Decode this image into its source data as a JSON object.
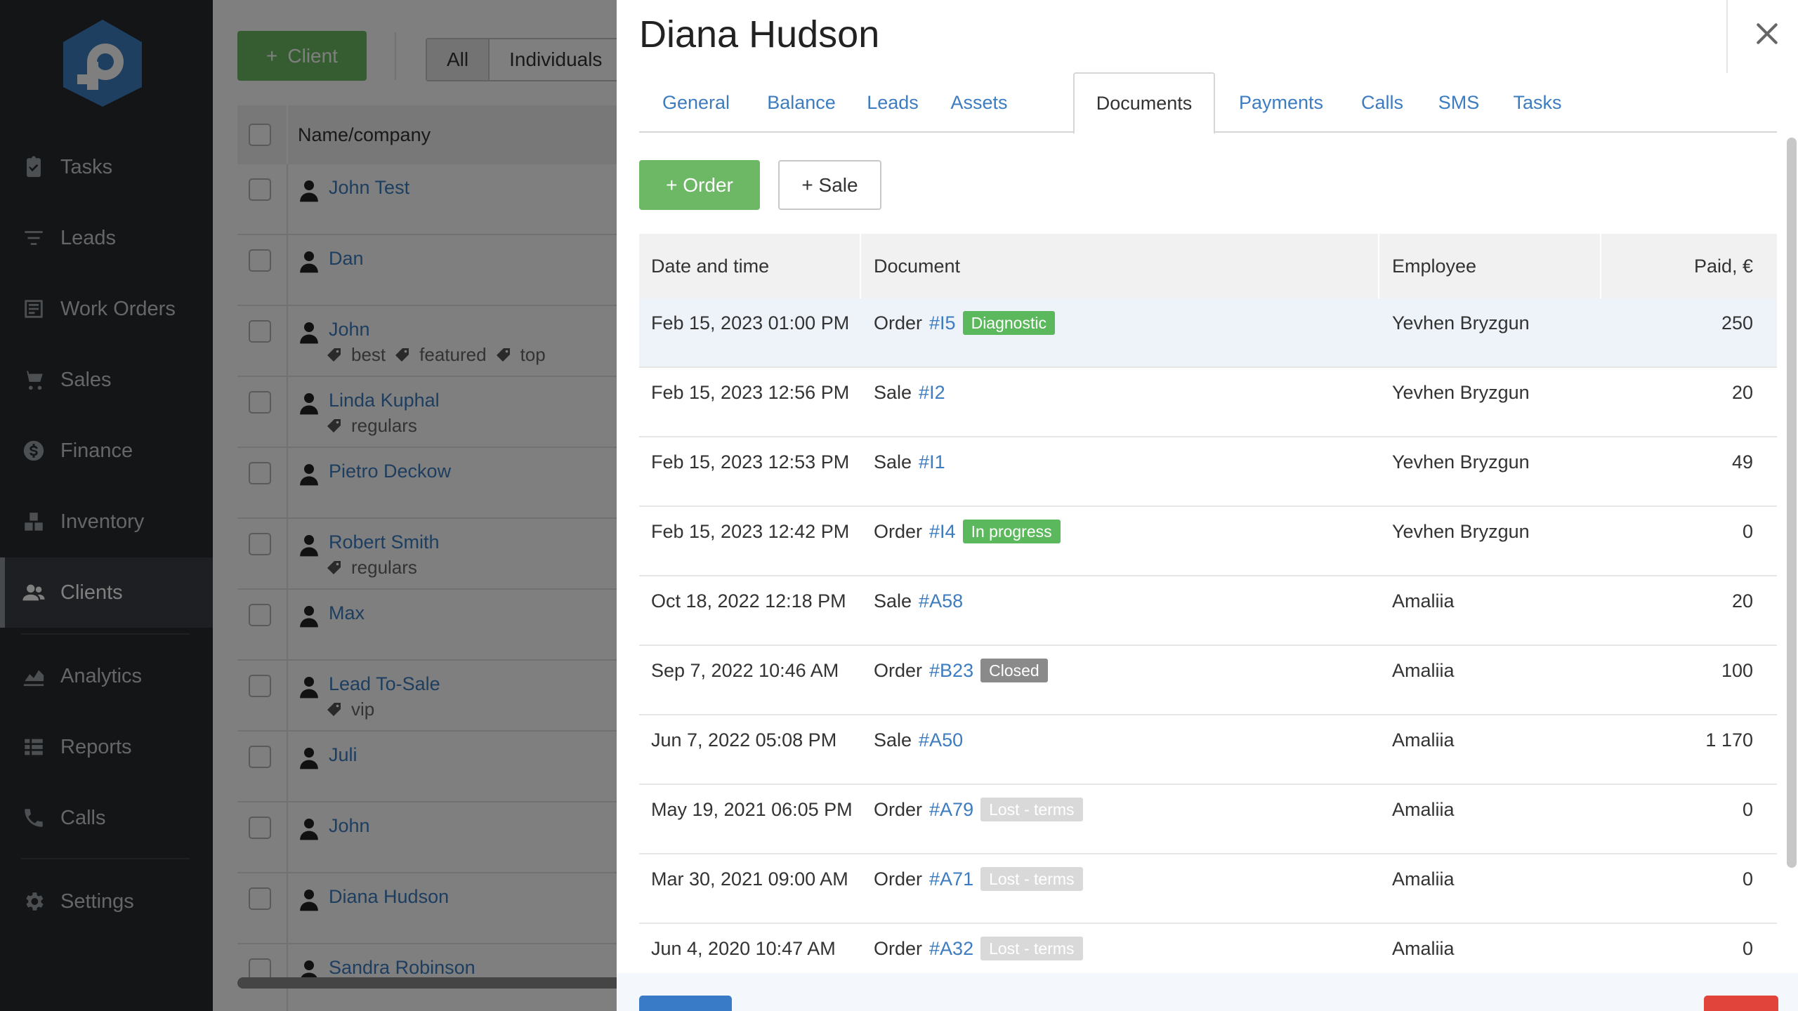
{
  "sidebar": {
    "items": [
      {
        "label": "Tasks",
        "icon": "clipboard-icon"
      },
      {
        "label": "Leads",
        "icon": "funnel-icon"
      },
      {
        "label": "Work Orders",
        "icon": "work-orders-icon"
      },
      {
        "label": "Sales",
        "icon": "cart-icon"
      },
      {
        "label": "Finance",
        "icon": "dollar-icon"
      },
      {
        "label": "Inventory",
        "icon": "boxes-icon"
      },
      {
        "label": "Clients",
        "icon": "users-icon",
        "active": true
      },
      {
        "label": "Analytics",
        "icon": "chart-icon"
      },
      {
        "label": "Reports",
        "icon": "list-icon"
      },
      {
        "label": "Calls",
        "icon": "phone-icon"
      },
      {
        "label": "Settings",
        "icon": "gear-icon"
      }
    ]
  },
  "clients_list": {
    "add_button": "Client",
    "filters": [
      "All",
      "Individuals"
    ],
    "header": "Name/company",
    "rows": [
      {
        "name": "John Test",
        "tags": []
      },
      {
        "name": "Dan",
        "tags": []
      },
      {
        "name": "John",
        "tags": [
          "best",
          "featured",
          "top"
        ]
      },
      {
        "name": "Linda Kuphal",
        "tags": [
          "regulars"
        ]
      },
      {
        "name": "Pietro Deckow",
        "tags": []
      },
      {
        "name": "Robert Smith",
        "tags": [
          "regulars"
        ]
      },
      {
        "name": "Max",
        "tags": []
      },
      {
        "name": "Lead To-Sale",
        "tags": [
          "vip"
        ]
      },
      {
        "name": "Juli",
        "tags": []
      },
      {
        "name": "John",
        "tags": []
      },
      {
        "name": "Diana Hudson",
        "tags": []
      },
      {
        "name": "Sandra Robinson",
        "tags": []
      }
    ]
  },
  "modal": {
    "title": "Diana Hudson",
    "tabs": [
      "General",
      "Balance",
      "Leads",
      "Assets",
      "Documents",
      "Payments",
      "Calls",
      "SMS",
      "Tasks"
    ],
    "active_tab": "Documents",
    "order_button": "+ Order",
    "sale_button": "+ Sale",
    "columns": [
      "Date and time",
      "Document",
      "Employee",
      "Paid, €"
    ],
    "rows": [
      {
        "date": "Feb 15, 2023 01:00 PM",
        "type": "Order",
        "doc": "#I5",
        "status": "Diagnostic",
        "status_color": "#5cb85c",
        "employee": "Yevhen Bryzgun",
        "paid": "250"
      },
      {
        "date": "Feb 15, 2023 12:56 PM",
        "type": "Sale",
        "doc": "#I2",
        "status": "",
        "status_color": "",
        "employee": "Yevhen Bryzgun",
        "paid": "20"
      },
      {
        "date": "Feb 15, 2023 12:53 PM",
        "type": "Sale",
        "doc": "#I1",
        "status": "",
        "status_color": "",
        "employee": "Yevhen Bryzgun",
        "paid": "49"
      },
      {
        "date": "Feb 15, 2023 12:42 PM",
        "type": "Order",
        "doc": "#I4",
        "status": "In progress",
        "status_color": "#5cb85c",
        "employee": "Yevhen Bryzgun",
        "paid": "0"
      },
      {
        "date": "Oct 18, 2022 12:18 PM",
        "type": "Sale",
        "doc": "#A58",
        "status": "",
        "status_color": "",
        "employee": "Amaliia",
        "paid": "20"
      },
      {
        "date": "Sep 7, 2022 10:46 AM",
        "type": "Order",
        "doc": "#B23",
        "status": "Closed",
        "status_color": "#8a8a8a",
        "employee": "Amaliia",
        "paid": "100"
      },
      {
        "date": "Jun 7, 2022 05:08 PM",
        "type": "Sale",
        "doc": "#A50",
        "status": "",
        "status_color": "",
        "employee": "Amaliia",
        "paid": "1 170"
      },
      {
        "date": "May 19, 2021 06:05 PM",
        "type": "Order",
        "doc": "#A79",
        "status": "Lost - terms",
        "status_color": "#d9d9d9",
        "employee": "Amaliia",
        "paid": "0"
      },
      {
        "date": "Mar 30, 2021 09:00 AM",
        "type": "Order",
        "doc": "#A71",
        "status": "Lost - terms",
        "status_color": "#d9d9d9",
        "employee": "Amaliia",
        "paid": "0"
      },
      {
        "date": "Jun 4, 2020 10:47 AM",
        "type": "Order",
        "doc": "#A32",
        "status": "Lost - terms",
        "status_color": "#d9d9d9",
        "employee": "Amaliia",
        "paid": "0"
      }
    ]
  },
  "colors": {
    "green": "#6cb865",
    "link": "#3d7cc0",
    "sidebar": "#262a2f"
  }
}
